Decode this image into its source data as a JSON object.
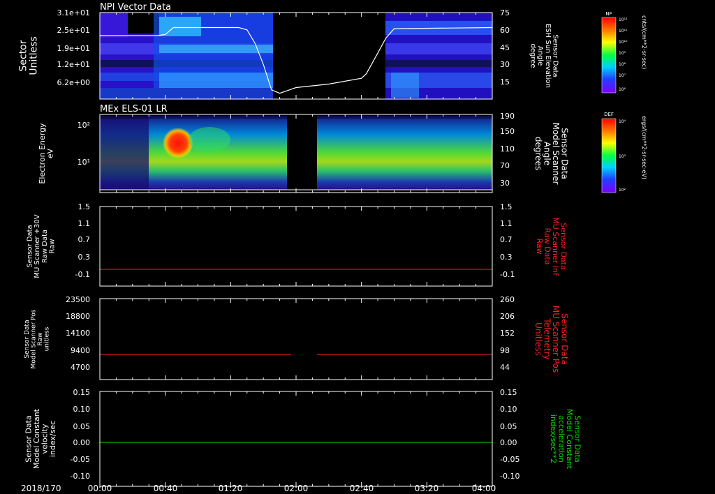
{
  "date_label": "2018/170",
  "time_ticks": [
    "00:00",
    "00:40",
    "01:20",
    "02:00",
    "02:40",
    "03:20",
    "04:00"
  ],
  "colors": {
    "background": "#000000",
    "axes": "#ffffff",
    "red_trace": "#ff2020",
    "green_trace": "#00e000",
    "white_trace": "#ffffff"
  },
  "colorbars": [
    {
      "title": "NF",
      "unit": "cnts/(cm**2-sr-sec)",
      "ticks": [
        "10¹²",
        "10¹¹",
        "10¹⁰",
        "10⁹",
        "10⁸",
        "10⁷",
        "10⁶"
      ],
      "icon": "rainbow-colorbar"
    },
    {
      "title": "DEF",
      "unit": "ergs/(cm**2-sr-sec-eV)",
      "ticks": [
        "10⁴",
        "10³",
        "10²"
      ],
      "icon": "rainbow-colorbar"
    }
  ],
  "chart_data": [
    {
      "type": "heatmap",
      "title": "NPI Vector Data",
      "ylabel": "Sector\nUnitless",
      "yticks": [
        "3.1e+01",
        "2.5e+01",
        "1.9e+01",
        "1.2e+01",
        "6.2e+00"
      ],
      "y2label": "Sensor Data\nESH Sun Elevation\nAngle\ndegree",
      "y2ticks": [
        "75",
        "60",
        "45",
        "30",
        "15"
      ],
      "y2lim": [
        0,
        75
      ],
      "data_gaps": [
        [
          "01:44",
          "02:20"
        ]
      ],
      "overlay_line": {
        "name": "ESH Sun Elevation Angle",
        "x": [
          "00:00",
          "00:35",
          "00:40",
          "00:45",
          "01:25",
          "01:30",
          "01:35",
          "01:40",
          "01:45",
          "01:50",
          "02:00",
          "02:20",
          "02:40",
          "02:43",
          "02:50",
          "02:55",
          "03:00",
          "04:00"
        ],
        "y": [
          55,
          55,
          56,
          62,
          62,
          60,
          48,
          30,
          8,
          5,
          10,
          13,
          18,
          22,
          40,
          53,
          61,
          62
        ]
      }
    },
    {
      "type": "heatmap",
      "title": "MEx ELS-01 LR",
      "ylabel": "Electron Energy\neV",
      "yticks": [
        "10²",
        "10¹"
      ],
      "y2label": "Sensor Data\nModel Scanner\nAngle\ndegrees",
      "y2ticks": [
        "190",
        "150",
        "110",
        "70",
        "30"
      ],
      "y2lim": [
        10,
        190
      ],
      "data_gaps": [
        [
          "01:50",
          "02:10"
        ]
      ],
      "features": "Broad mid-energy band (~5-20 eV); intense red/orange hotspot near 00:40-00:50 at ~50-100 eV"
    },
    {
      "type": "line",
      "ylabel": "Sensor Data\nMU Scanner +30V\nRaw Data\nRaw",
      "yticks": [
        "1.5",
        "1.1",
        "0.7",
        "0.3",
        "-0.1"
      ],
      "ylim": [
        -0.3,
        1.5
      ],
      "y2label": "Sensor Data\nMU Scanner Inf\nRaw Data\nRaw",
      "y2ticks": [
        "1.5",
        "1.1",
        "0.7",
        "0.3",
        "-0.1"
      ],
      "series": [
        {
          "color": "red",
          "x": [
            "00:00",
            "04:00"
          ],
          "y": [
            0.0,
            0.0
          ]
        }
      ]
    },
    {
      "type": "line",
      "ylabel": "Sensor Data\nModel Scanner Pos\nRaw\nunitless",
      "yticks": [
        "23500",
        "18800",
        "14100",
        "9400",
        "4700"
      ],
      "ylim": [
        0,
        23500
      ],
      "y2label": "Sensor Data\nMU Scanner Pos\nTelemetry\nUnitless",
      "y2ticks": [
        "260",
        "206",
        "152",
        "98",
        "44"
      ],
      "series": [
        {
          "color": "red",
          "segments": [
            {
              "x": [
                "00:00",
                "01:50"
              ],
              "y": [
                8100,
                8100
              ]
            },
            {
              "x": [
                "02:10",
                "04:00"
              ],
              "y": [
                8100,
                8100
              ]
            }
          ]
        }
      ]
    },
    {
      "type": "line",
      "ylabel": "Sensor Data\nModel Constant\nvelocity\nindex/sec",
      "yticks": [
        "0.15",
        "0.10",
        "0.05",
        "0.00",
        "-0.05",
        "-0.10"
      ],
      "ylim": [
        -0.1,
        0.15
      ],
      "y2label": "Sensor Data\nModel Constant\nacceleration\nindex/sec**2",
      "y2ticks": [
        "0.15",
        "0.10",
        "0.05",
        "0.00",
        "-0.05",
        "-0.10"
      ],
      "series": [
        {
          "color": "green",
          "x": [
            "00:00",
            "04:00"
          ],
          "y": [
            0.0,
            0.0
          ]
        }
      ]
    }
  ]
}
